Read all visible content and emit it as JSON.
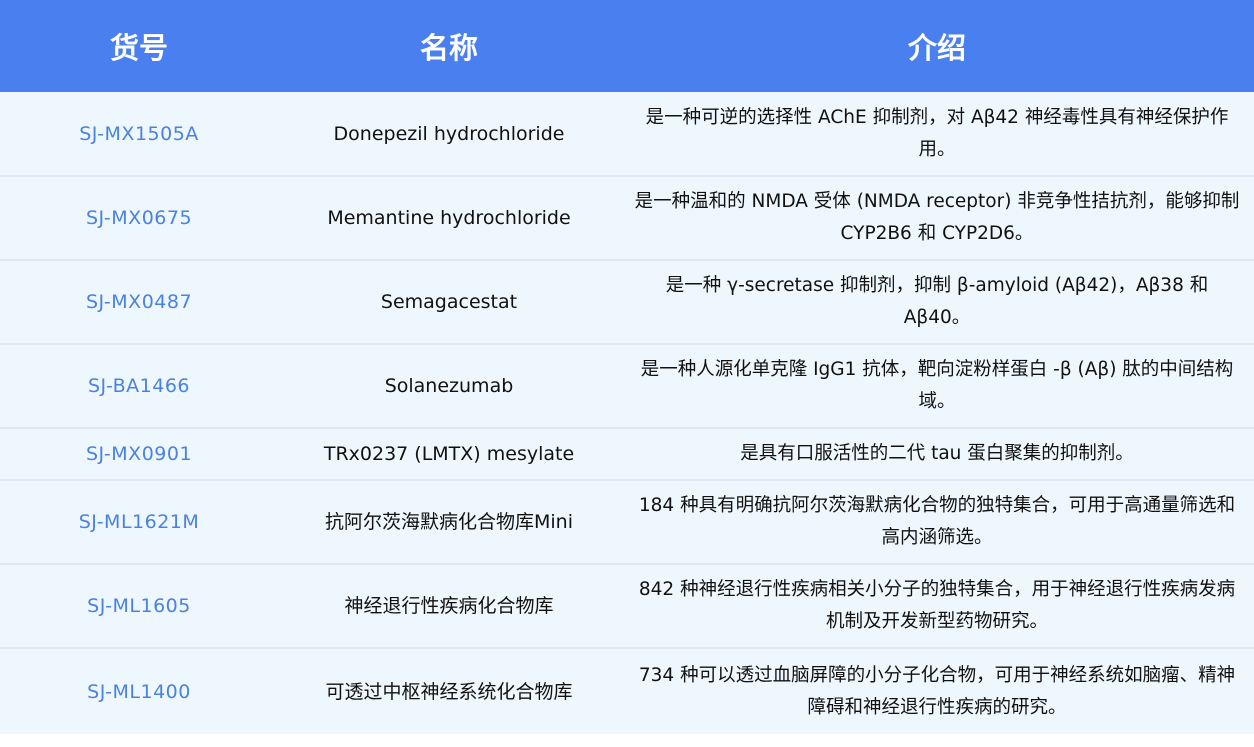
{
  "header": {
    "col_code": "货号",
    "col_name": "名称",
    "col_desc": "介绍"
  },
  "rows": [
    {
      "code": "SJ-MX1505A",
      "name": "Donepezil hydrochloride",
      "desc": "是一种可逆的选择性 AChE 抑制剂，对 Aβ42 神经毒性具有神经保护作用。"
    },
    {
      "code": "SJ-MX0675",
      "name": "Memantine hydrochloride",
      "desc": "是一种温和的 NMDA 受体 (NMDA receptor) 非竞争性拮抗剂，能够抑制 CYP2B6 和 CYP2D6。"
    },
    {
      "code": "SJ-MX0487",
      "name": "Semagacestat",
      "desc": "是一种 γ-secretase 抑制剂，抑制 β-amyloid (Aβ42)，Aβ38 和 Aβ40。"
    },
    {
      "code": "SJ-BA1466",
      "name": "Solanezumab",
      "desc": "是一种人源化单克隆 IgG1 抗体，靶向淀粉样蛋白 -β (Aβ) 肽的中间结构域。"
    },
    {
      "code": "SJ-MX0901",
      "name": "TRx0237 (LMTX) mesylate",
      "desc": "是具有口服活性的二代 tau 蛋白聚集的抑制剂。"
    },
    {
      "code": "SJ-ML1621M",
      "name": "抗阿尔茨海默病化合物库Mini",
      "desc": "184 种具有明确抗阿尔茨海默病化合物的独特集合，可用于高通量筛选和高内涵筛选。"
    },
    {
      "code": "SJ-ML1605",
      "name": "神经退行性疾病化合物库",
      "desc": "842 种神经退行性疾病相关小分子的独特集合，用于神经退行性疾病发病机制及开发新型药物研究。"
    },
    {
      "code": "SJ-ML1400",
      "name": "可透过中枢神经系统化合物库",
      "desc": "734 种可以透过血脑屏障的小分子化合物，可用于神经系统如脑瘤、精神障碍和神经退行性疾病的研究。"
    }
  ]
}
